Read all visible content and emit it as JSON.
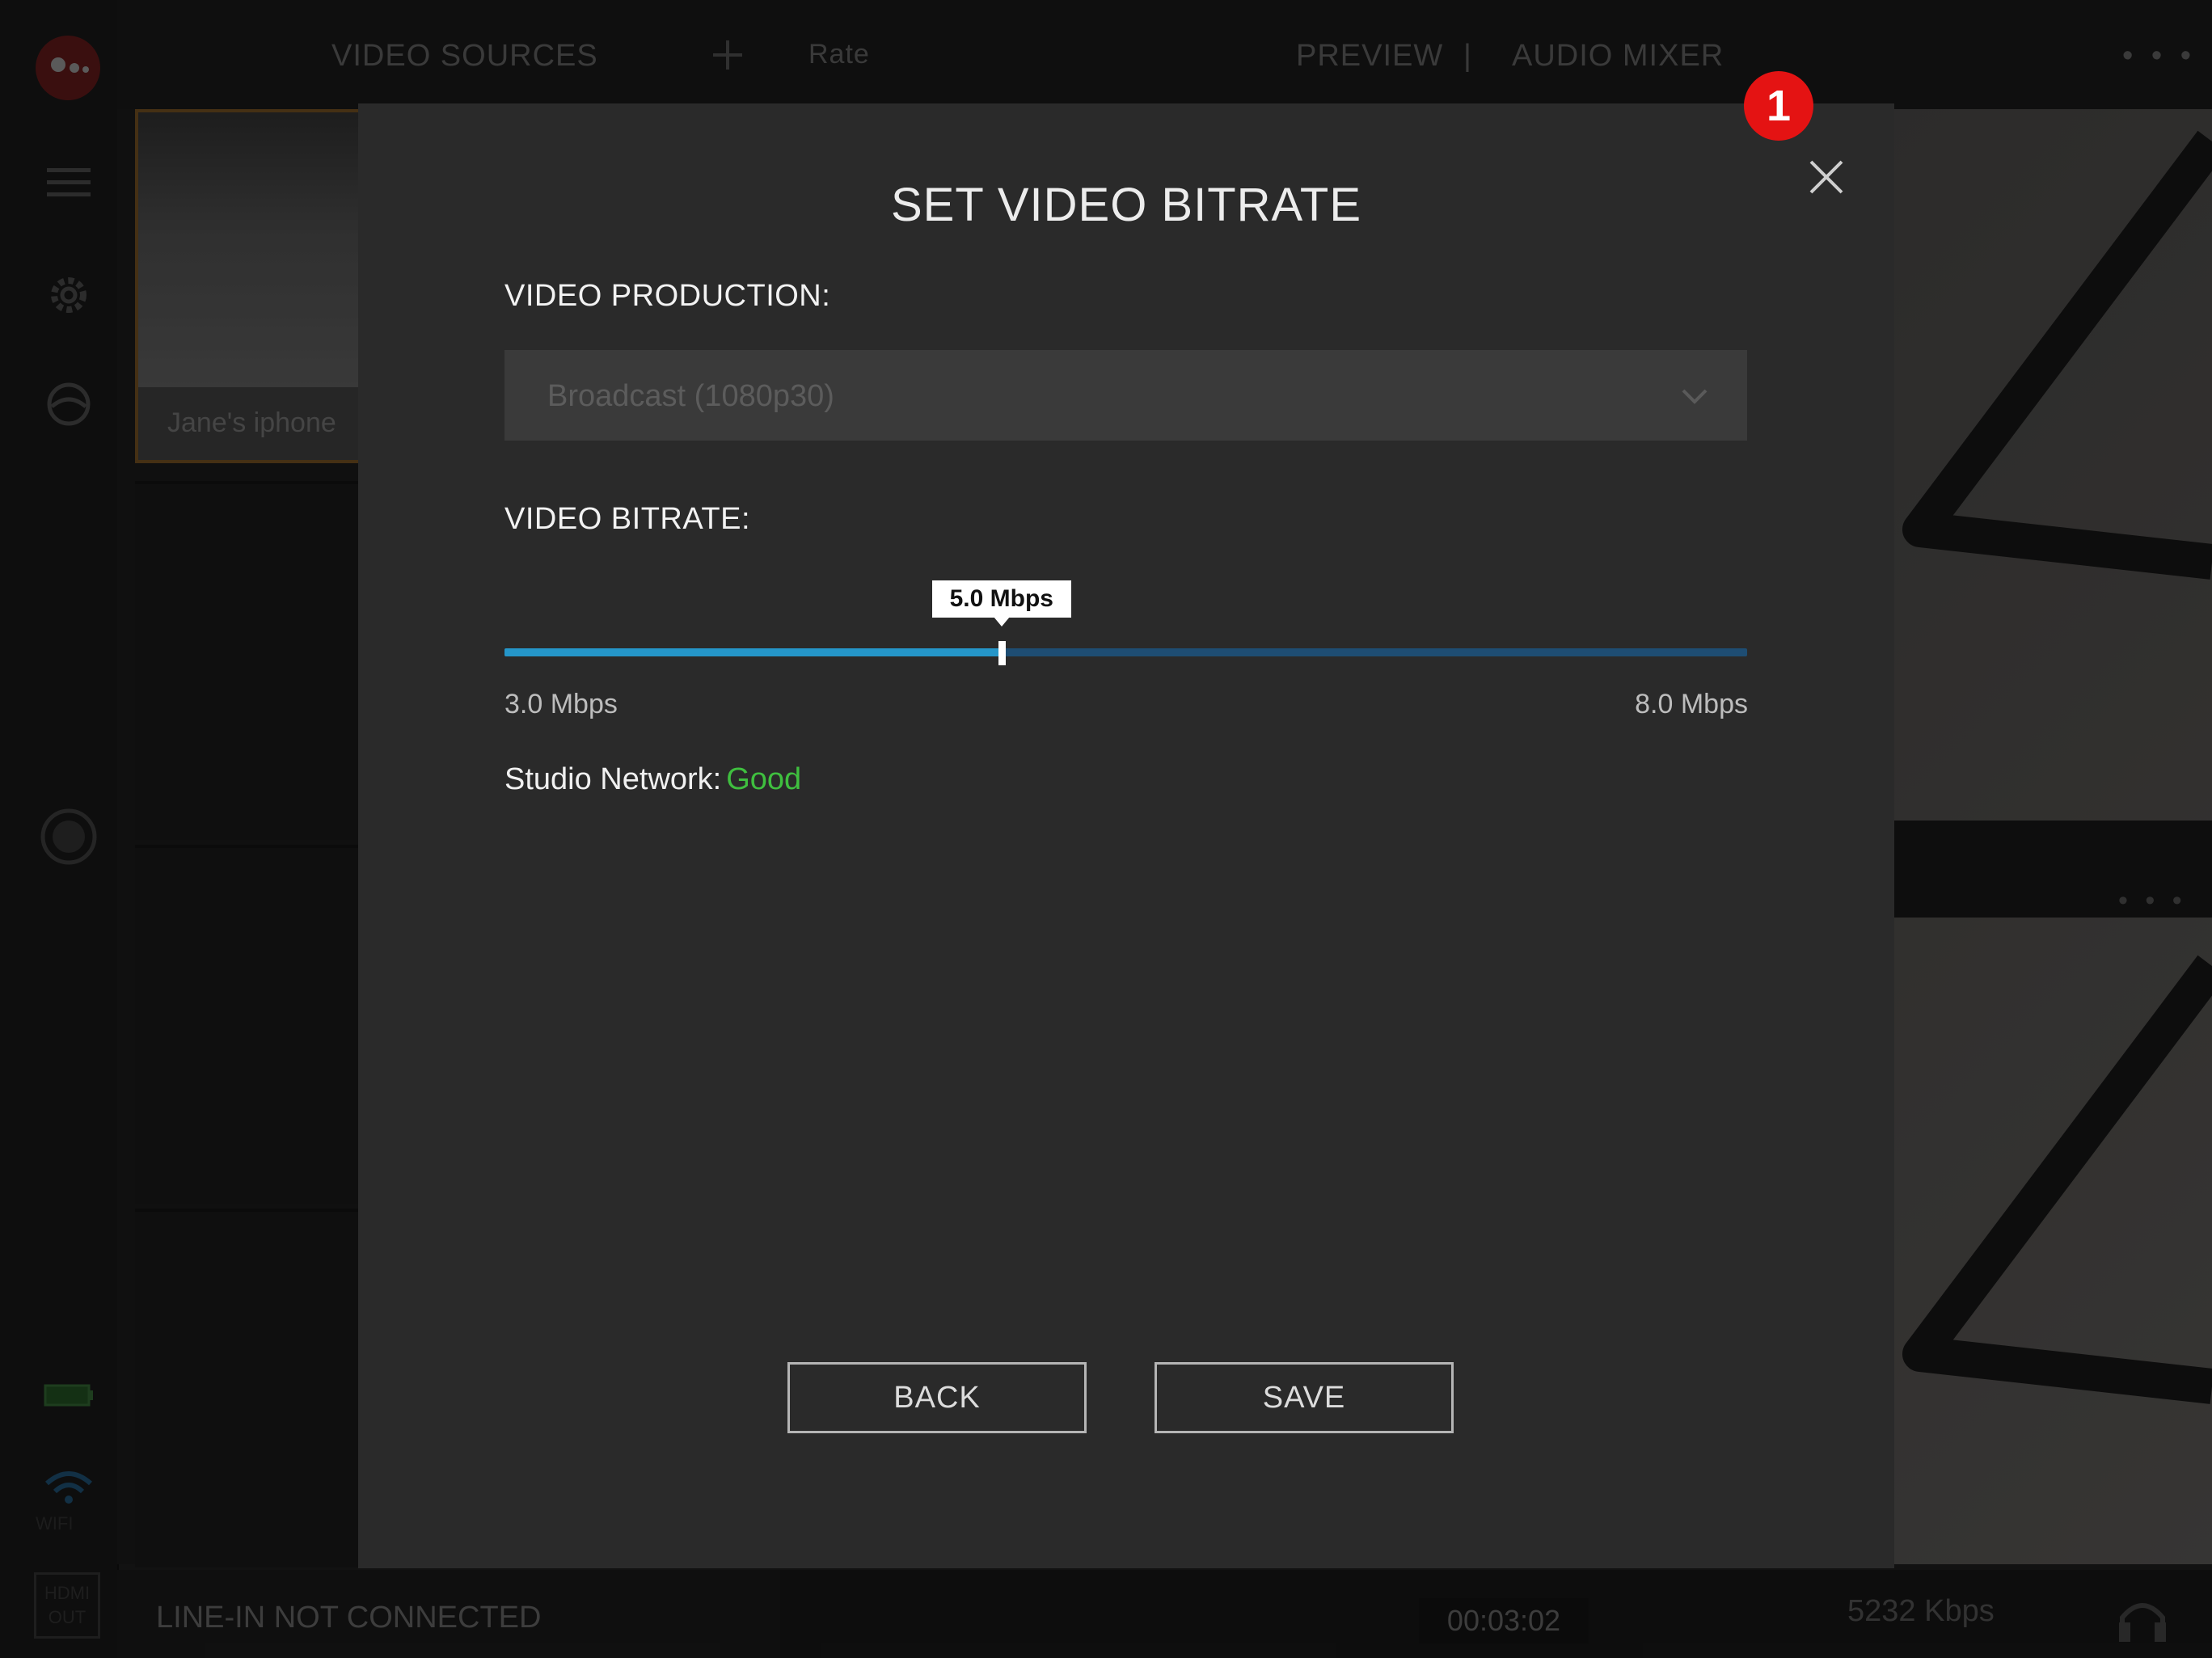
{
  "app": {
    "sidebar_icons": [
      "menu-icon",
      "gear-icon",
      "globe-icon",
      "record-icon",
      "battery-icon",
      "wifi-icon",
      "hdmi-out-icon"
    ],
    "wifi_label": "WIFI",
    "hdmi_label": "HDMI\nOUT"
  },
  "topbar": {
    "video_sources": "VIDEO SOURCES",
    "add_icon": "plus-icon",
    "rate": "Rate",
    "preview": "PREVIEW",
    "separator": "|",
    "audio_mixer": "AUDIO MIXER",
    "more_icon": "more-dots-icon"
  },
  "sources": [
    {
      "label": "Jane's iphone"
    }
  ],
  "bottombar": {
    "line_in": "LINE-IN NOT CONNECTED",
    "timer": "00:03:02",
    "bitrate": "5232 Kbps",
    "headphones_icon": "headphones-icon"
  },
  "modal": {
    "title": "SET VIDEO BITRATE",
    "close_icon": "close-icon",
    "badge": "1",
    "production_label": "VIDEO PRODUCTION:",
    "production_value": "Broadcast (1080p30)",
    "bitrate_label": "VIDEO BITRATE:",
    "slider": {
      "min": 3.0,
      "max": 8.0,
      "value": 5.0,
      "value_label": "5.0 Mbps",
      "min_label": "3.0 Mbps",
      "max_label": "8.0 Mbps"
    },
    "network_label": "Studio Network:",
    "network_status": "Good",
    "back_button": "BACK",
    "save_button": "SAVE"
  },
  "colors": {
    "accent_blue": "#2596c9",
    "status_good": "#3fbf3f",
    "badge_red": "#e41313"
  }
}
